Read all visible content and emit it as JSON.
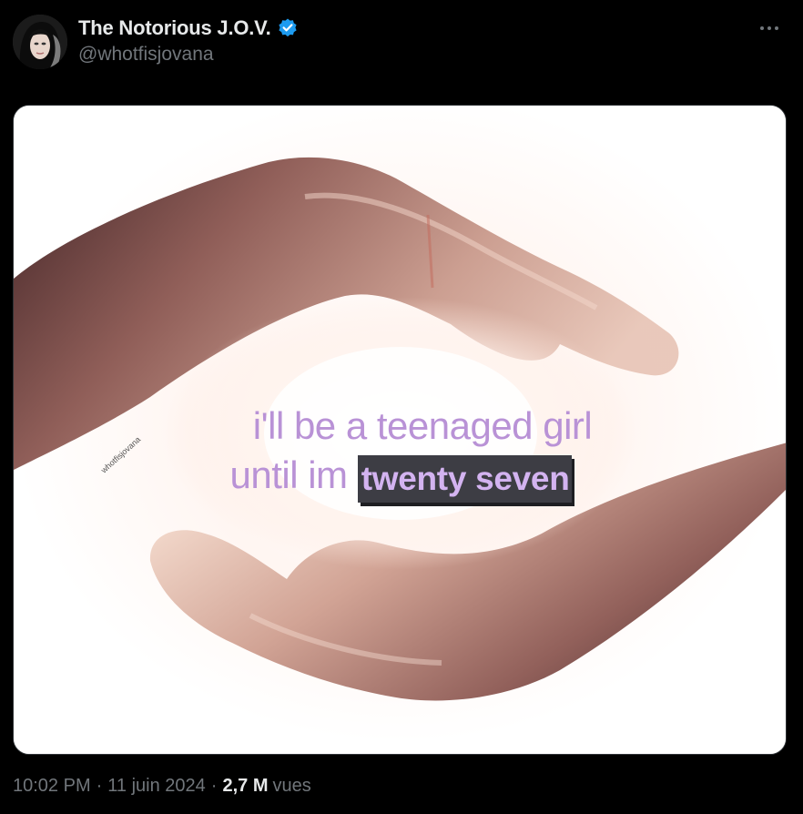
{
  "author": {
    "display_name": "The Notorious J.O.V.",
    "handle": "@whotfisjovana",
    "verified": true
  },
  "more_icon": "more-horizontal-icon",
  "media": {
    "caption_line1": "i'll be a teenaged girl",
    "caption_line2_plain": "until im",
    "caption_line2_highlight": "twenty seven",
    "watermark": "whotfisjovana"
  },
  "meta": {
    "time": "10:02 PM",
    "separator": "·",
    "date": "11 juin 2024",
    "views_count": "2,7 M",
    "views_label": "vues"
  },
  "colors": {
    "background": "#000000",
    "text_primary": "#e7e9ea",
    "text_secondary": "#71767b",
    "verified_blue": "#1d9bf0",
    "caption_lavender": "#b992d6"
  }
}
